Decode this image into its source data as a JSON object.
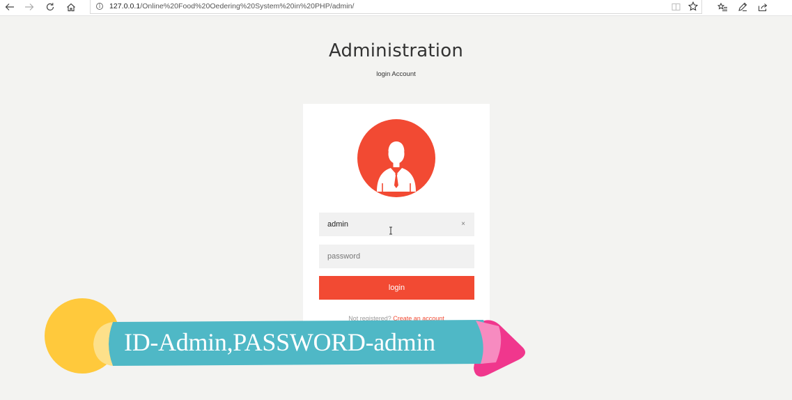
{
  "browser": {
    "url_host": "127.0.0.1",
    "url_path": "/Online%20Food%20Oedering%20System%20in%20PHP/admin/",
    "icons": [
      "back-icon",
      "forward-icon",
      "refresh-icon",
      "home-icon",
      "info-icon",
      "reading-view-icon",
      "favorite-star-icon",
      "favorites-hub-icon",
      "pen-icon",
      "share-icon"
    ]
  },
  "header": {
    "title": "Administration",
    "subtitle": "login Account"
  },
  "login_form": {
    "avatar_icon": "admin-user-icon",
    "username_value": "admin",
    "password_placeholder": "password",
    "clear_symbol": "×",
    "login_label": "login",
    "register_text": "Not registered?",
    "register_link": "Create an account"
  },
  "overlay": {
    "caption": "ID-Admin,PASSWORD-admin"
  },
  "colors": {
    "accent": "#f24a33",
    "background": "#f3f3f1",
    "banner_teal": "#4fb8c6",
    "banner_yellow": "#ffc93c",
    "banner_pink": "#f0378d"
  }
}
